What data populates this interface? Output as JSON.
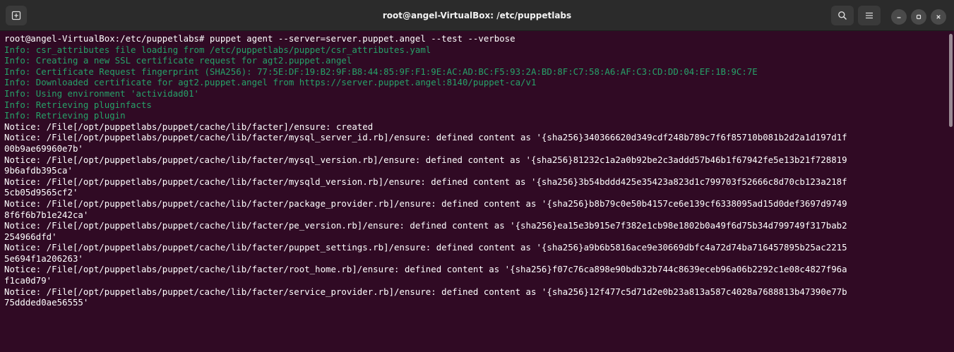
{
  "window": {
    "title": "root@angel-VirtualBox: /etc/puppetlabs"
  },
  "icons": {
    "new_tab": "new-tab-icon",
    "search": "search-icon",
    "menu": "hamburger-menu-icon",
    "minimize": "minimize-icon",
    "maximize": "maximize-icon",
    "close": "close-icon"
  },
  "colors": {
    "terminal_bg": "#300a24",
    "info_text": "#26a269",
    "normal_text": "#ffffff",
    "titlebar_bg": "#2b2b2b"
  },
  "terminal": {
    "lines": [
      {
        "type": "prompt",
        "text": "root@angel-VirtualBox:/etc/puppetlabs# puppet agent --server=server.puppet.angel --test --verbose"
      },
      {
        "type": "info",
        "text": "Info: csr_attributes file loading from /etc/puppetlabs/puppet/csr_attributes.yaml"
      },
      {
        "type": "info",
        "text": "Info: Creating a new SSL certificate request for agt2.puppet.angel"
      },
      {
        "type": "info",
        "text": "Info: Certificate Request fingerprint (SHA256): 77:5E:DF:19:B2:9F:B8:44:85:9F:F1:9E:AC:AD:BC:F5:93:2A:BD:8F:C7:58:A6:AF:C3:CD:DD:04:EF:1B:9C:7E"
      },
      {
        "type": "info",
        "text": "Info: Downloaded certificate for agt2.puppet.angel from https://server.puppet.angel:8140/puppet-ca/v1"
      },
      {
        "type": "info",
        "text": "Info: Using environment 'actividad01'"
      },
      {
        "type": "info",
        "text": "Info: Retrieving pluginfacts"
      },
      {
        "type": "info",
        "text": "Info: Retrieving plugin"
      },
      {
        "type": "notice",
        "text": "Notice: /File[/opt/puppetlabs/puppet/cache/lib/facter]/ensure: created"
      },
      {
        "type": "notice",
        "text": "Notice: /File[/opt/puppetlabs/puppet/cache/lib/facter/mysql_server_id.rb]/ensure: defined content as '{sha256}340366620d349cdf248b789c7f6f85710b081b2d2a1d197d1f"
      },
      {
        "type": "notice",
        "text": "00b9ae69960e7b'"
      },
      {
        "type": "notice",
        "text": "Notice: /File[/opt/puppetlabs/puppet/cache/lib/facter/mysql_version.rb]/ensure: defined content as '{sha256}81232c1a2a0b92be2c3addd57b46b1f67942fe5e13b21f728819"
      },
      {
        "type": "notice",
        "text": "9b6afdb395ca'"
      },
      {
        "type": "notice",
        "text": "Notice: /File[/opt/puppetlabs/puppet/cache/lib/facter/mysqld_version.rb]/ensure: defined content as '{sha256}3b54bddd425e35423a823d1c799703f52666c8d70cb123a218f"
      },
      {
        "type": "notice",
        "text": "5cb05d9565cf2'"
      },
      {
        "type": "notice",
        "text": "Notice: /File[/opt/puppetlabs/puppet/cache/lib/facter/package_provider.rb]/ensure: defined content as '{sha256}b8b79c0e50b4157ce6e139cf6338095ad15d0def3697d9749"
      },
      {
        "type": "notice",
        "text": "8f6f6b7b1e242ca'"
      },
      {
        "type": "notice",
        "text": "Notice: /File[/opt/puppetlabs/puppet/cache/lib/facter/pe_version.rb]/ensure: defined content as '{sha256}ea15e3b915e7f382e1cb98e1802b0a49f6d75b34d799749f317bab2"
      },
      {
        "type": "notice",
        "text": "254966dfd'"
      },
      {
        "type": "notice",
        "text": "Notice: /File[/opt/puppetlabs/puppet/cache/lib/facter/puppet_settings.rb]/ensure: defined content as '{sha256}a9b6b5816ace9e30669dbfc4a72d74ba716457895b25ac2215"
      },
      {
        "type": "notice",
        "text": "5e694f1a206263'"
      },
      {
        "type": "notice",
        "text": "Notice: /File[/opt/puppetlabs/puppet/cache/lib/facter/root_home.rb]/ensure: defined content as '{sha256}f07c76ca898e90bdb32b744c8639eceb96a06b2292c1e08c4827f96a"
      },
      {
        "type": "notice",
        "text": "f1ca0d79'"
      },
      {
        "type": "notice",
        "text": "Notice: /File[/opt/puppetlabs/puppet/cache/lib/facter/service_provider.rb]/ensure: defined content as '{sha256}12f477c5d71d2e0b23a813a587c4028a7688813b47390e77b"
      },
      {
        "type": "notice",
        "text": "75ddded0ae56555'"
      }
    ]
  }
}
